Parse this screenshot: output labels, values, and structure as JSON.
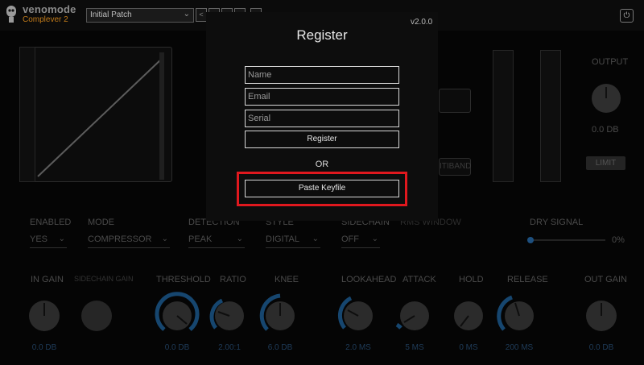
{
  "header": {
    "brand": "venomode",
    "product": "Complever 2",
    "preset": "Initial Patch",
    "nav_prev": "<",
    "power_glyph": "⏻"
  },
  "background": {
    "output_label": "OUTPUT",
    "output_value": "0.0 DB",
    "limit_button": "LIMIT",
    "multiband_button": "ITIBAND",
    "controls": {
      "enabled": {
        "label": "ENABLED",
        "value": "YES"
      },
      "mode": {
        "label": "MODE",
        "value": "COMPRESSOR"
      },
      "detection": {
        "label": "DETECTION",
        "value": "PEAK"
      },
      "style": {
        "label": "STYLE",
        "value": "DIGITAL"
      },
      "sidechain": {
        "label": "SIDECHAIN",
        "value": "OFF"
      },
      "rms_window": {
        "label": "RMS WINDOW"
      },
      "dry_signal": {
        "label": "DRY SIGNAL",
        "value": "0%"
      }
    },
    "knobs": [
      {
        "label": "IN GAIN",
        "value": "0.0 DB"
      },
      {
        "label": "SIDECHAIN GAIN",
        "value": ""
      },
      {
        "label": "THRESHOLD",
        "value": "0.0 DB"
      },
      {
        "label": "RATIO",
        "value": "2.00:1"
      },
      {
        "label": "KNEE",
        "value": "6.0 DB"
      },
      {
        "label": "LOOKAHEAD",
        "value": "2.0 MS"
      },
      {
        "label": "ATTACK",
        "value": "5 MS"
      },
      {
        "label": "HOLD",
        "value": "0 MS"
      },
      {
        "label": "RELEASE",
        "value": "200 MS"
      },
      {
        "label": "OUT GAIN",
        "value": "0.0 DB"
      }
    ]
  },
  "dialog": {
    "version": "v2.0.0",
    "title": "Register",
    "name_placeholder": "Name",
    "email_placeholder": "Email",
    "serial_placeholder": "Serial",
    "register_button": "Register",
    "or_text": "OR",
    "paste_button": "Paste Keyfile"
  },
  "colors": {
    "highlight": "#e0181e",
    "knob_arc": "#1d6fb0",
    "brand_accent": "#c07a1a"
  }
}
